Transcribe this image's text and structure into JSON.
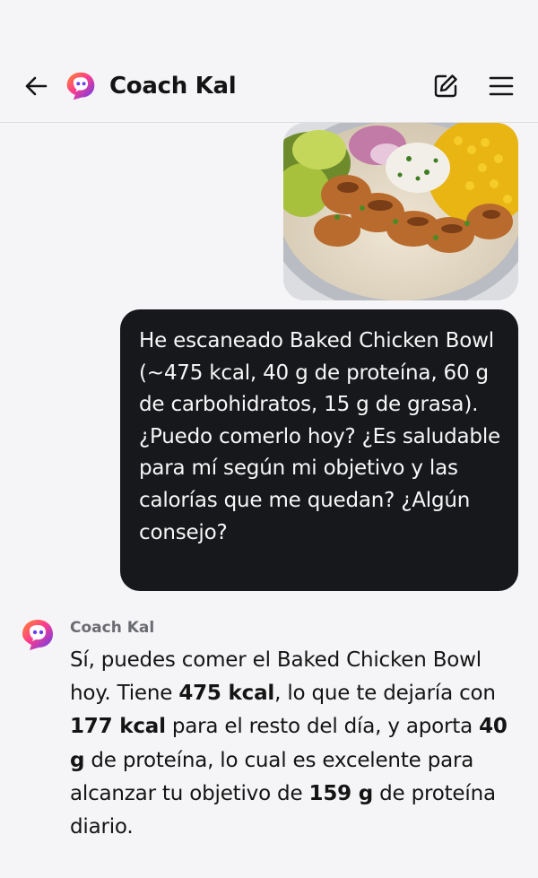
{
  "header": {
    "title": "Coach Kal",
    "back_icon": "arrow-left-icon",
    "edit_icon": "edit-note-icon",
    "menu_icon": "hamburger-menu-icon"
  },
  "chat": {
    "food_image_alt": "Baked Chicken Bowl photo",
    "user_message": "He escaneado Baked Chicken Bowl (~475 kcal, 40 g de proteína, 60 g de carbohidratos, 15 g de grasa). ¿Puedo comerlo hoy? ¿Es saludable para mí según mi objetivo y las calorías que me quedan? ¿Algún consejo?",
    "bot_name": "Coach Kal",
    "bot_reply": {
      "p1": "Sí, puedes comer el Baked Chicken Bowl hoy. Tiene ",
      "kcal": "475 kcal",
      "p2": ", lo que te dejaría con ",
      "remaining": "177 kcal",
      "p3": " para el resto del día, y aporta ",
      "protein": "40 g",
      "p4": " de proteína, lo cual es excelente para alcanzar tu objetivo de ",
      "goal": "159 g",
      "p5": " de proteína diario."
    }
  },
  "colors": {
    "background": "#f5f5f7",
    "user_bubble": "#17181c",
    "text": "#141414",
    "muted": "#6b6b72"
  }
}
